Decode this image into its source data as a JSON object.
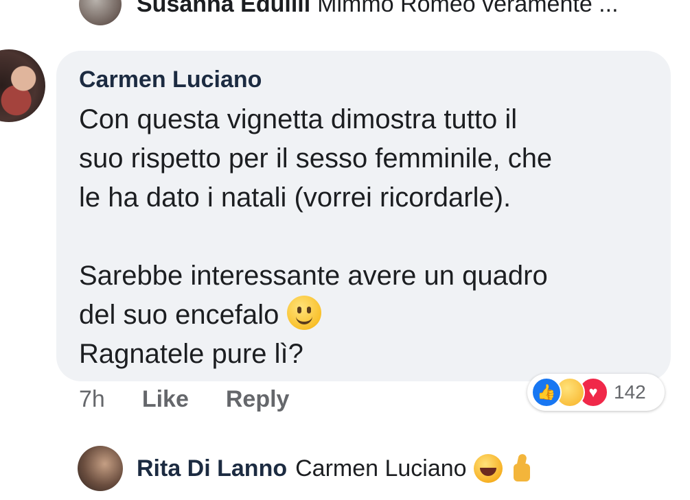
{
  "top_reply": {
    "author": "Susanna Edullli",
    "text": "Mimmo Romeo veramente ..."
  },
  "comment": {
    "author": "Carmen Luciano",
    "lines": [
      "Con questa vignetta dimostra tutto  il",
      "suo rispetto per il sesso femminile, che",
      "le ha dato i natali (vorrei ricordarle).",
      "Sarebbe interessante avere un quadro",
      "del suo encefalo",
      "Ragnatele pure lì?"
    ],
    "time": "7h",
    "like_label": "Like",
    "reply_label": "Reply",
    "reactions": {
      "icons": [
        "like-icon",
        "haha-icon",
        "love-icon"
      ],
      "count": "142"
    }
  },
  "reply": {
    "author": "Rita Di Lanno",
    "text": "Carmen Luciano"
  },
  "colors": {
    "bubble": "#f0f2f5",
    "like_blue": "#1877f2",
    "love_red": "#f02849",
    "muted": "#65676b"
  }
}
